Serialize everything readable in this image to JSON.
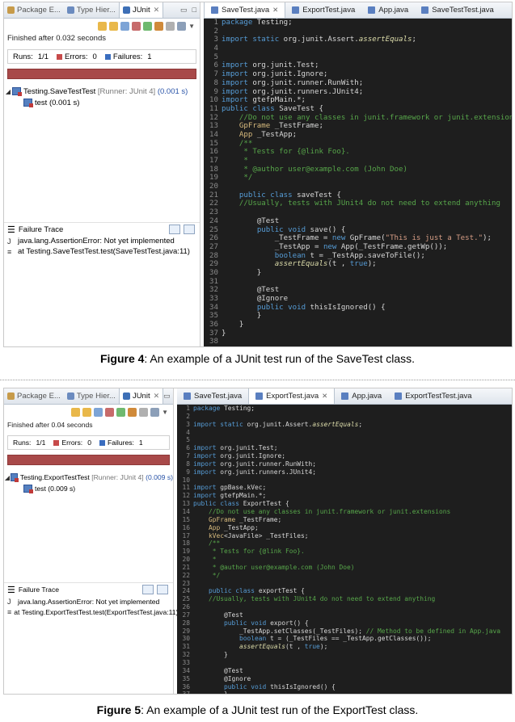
{
  "figures": [
    {
      "views": [
        {
          "label": "Package E...",
          "icon": "package-explorer-icon"
        },
        {
          "label": "Type Hier...",
          "icon": "type-hierarchy-icon"
        },
        {
          "label": "JUnit",
          "icon": "junit-icon",
          "active": true
        }
      ],
      "status": "Finished after 0.032 seconds",
      "runs_label": "Runs:",
      "runs_value": "1/1",
      "errors_label": "Errors:",
      "errors_value": "0",
      "failures_label": "Failures:",
      "failures_value": "1",
      "tree": {
        "suite": "Testing.SaveTestTest",
        "runner": "[Runner: JUnit 4]",
        "time": "(0.001 s)",
        "test": "test (0.001 s)"
      },
      "failure_trace_label": "Failure Trace",
      "trace": [
        "java.lang.AssertionError: Not yet implemented",
        "at Testing.SaveTestTest.test(SaveTestTest.java:11)"
      ],
      "editor_tabs": [
        "SaveTest.java",
        "ExportTest.java",
        "App.java",
        "SaveTestTest.java"
      ],
      "active_editor_tab": 0,
      "code": [
        "package Testing;",
        "",
        "import static org.junit.Assert.assertEquals;",
        "",
        "",
        "import org.junit.Test;",
        "import org.junit.Ignore;",
        "import org.junit.runner.RunWith;",
        "import org.junit.runners.JUnit4;",
        "import gtefpMain.*;",
        "public class SaveTest {",
        "    //Do not use any classes in junit.framework or junit.extensions",
        "    GpFrame _TestFrame;",
        "    App _TestApp;",
        "    /**",
        "     * Tests for {@link Foo}.",
        "     *",
        "     * @author user@example.com (John Doe)",
        "     */",
        "",
        "    public class saveTest {",
        "    //Usually, tests with JUnit4 do not need to extend anything",
        "",
        "        @Test",
        "        public void save() {",
        "            _TestFrame = new GpFrame(\"This is just a Test.\");",
        "            _TestApp = new App(_TestFrame.getWp());",
        "            boolean t = _TestApp.saveToFile();",
        "            assertEquals(t , true);",
        "        }",
        "",
        "        @Test",
        "        @Ignore",
        "        public void thisIsIgnored() {",
        "        }",
        "    }",
        "}",
        ""
      ],
      "caption_bold": "Figure 4",
      "caption_rest": ": An example of a JUnit test run of the SaveTest class."
    },
    {
      "views": [
        {
          "label": "Package E...",
          "icon": "package-explorer-icon"
        },
        {
          "label": "Type Hier...",
          "icon": "type-hierarchy-icon"
        },
        {
          "label": "JUnit",
          "icon": "junit-icon",
          "active": true
        }
      ],
      "status": "Finished after 0.04 seconds",
      "runs_label": "Runs:",
      "runs_value": "1/1",
      "errors_label": "Errors:",
      "errors_value": "0",
      "failures_label": "Failures:",
      "failures_value": "1",
      "tree": {
        "suite": "Testing.ExportTestTest",
        "runner": "[Runner: JUnit 4]",
        "time": "(0.009 s)",
        "test": "test (0.009 s)"
      },
      "failure_trace_label": "Failure Trace",
      "trace": [
        "java.lang.AssertionError: Not yet implemented",
        "at Testing.ExportTestTest.test(ExportTestTest.java:11)"
      ],
      "editor_tabs": [
        "SaveTest.java",
        "ExportTest.java",
        "App.java",
        "ExportTestTest.java"
      ],
      "active_editor_tab": 1,
      "code": [
        "package Testing;",
        "",
        "import static org.junit.Assert.assertEquals;",
        "",
        "",
        "import org.junit.Test;",
        "import org.junit.Ignore;",
        "import org.junit.runner.RunWith;",
        "import org.junit.runners.JUnit4;",
        "",
        "import gpBase.kVec;",
        "import gtefpMain.*;",
        "public class ExportTest {",
        "    //Do not use any classes in junit.framework or junit.extensions",
        "    GpFrame _TestFrame;",
        "    App _TestApp;",
        "    kVec<JavaFile> _TestFiles;",
        "    /**",
        "     * Tests for {@link Foo}.",
        "     *",
        "     * @author user@example.com (John Doe)",
        "     */",
        "",
        "    public class exportTest {",
        "    //Usually, tests with JUnit4 do not need to extend anything",
        "",
        "        @Test",
        "        public void export() {",
        "            _TestApp.setClasses(_TestFiles); // Method to be defined in App.java",
        "            boolean t = (_TestFiles == _TestApp.getClasses());",
        "            assertEquals(t , true);",
        "        }",
        "",
        "        @Test",
        "        @Ignore",
        "        public void thisIsIgnored() {",
        "        }",
        "    }",
        "}"
      ],
      "caption_bold": "Figure 5",
      "caption_rest": ": An example of a JUnit test run of the ExportTest class."
    }
  ]
}
